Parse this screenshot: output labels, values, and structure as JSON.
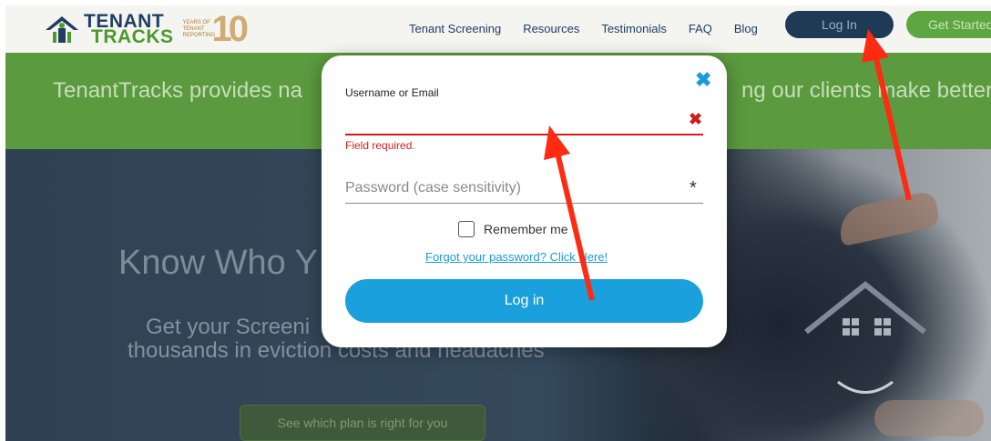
{
  "header": {
    "logo_line1": "TENANT",
    "logo_line2": "TRACKS",
    "years_badge": "YEARS OF TENANT REPORTING",
    "years_number": "10",
    "nav": [
      "Tenant Screening",
      "Resources",
      "Testimonials",
      "FAQ",
      "Blog"
    ],
    "login_label": "Log In",
    "get_started_label": "Get Started"
  },
  "band": {
    "text_left": "TenantTracks provides na",
    "text_right": "ng our clients make better"
  },
  "hero": {
    "title": "Know Who Y",
    "sub1": "Get your Screeni",
    "sub2": "thousands in eviction costs and headaches",
    "cta": "See which plan is right for you"
  },
  "modal": {
    "username_label": "Username or Email",
    "username_value": "",
    "error_message": "Field required.",
    "password_placeholder": "Password (case sensitivity)",
    "required_mark": "*",
    "remember_label": "Remember me",
    "remember_checked": false,
    "forgot_label": "Forgot your password? Click Here!",
    "login_button": "Log in"
  },
  "colors": {
    "accent": "#1aa0dd",
    "error": "#cc1f1f",
    "annotation_arrow": "#ff2a12"
  }
}
